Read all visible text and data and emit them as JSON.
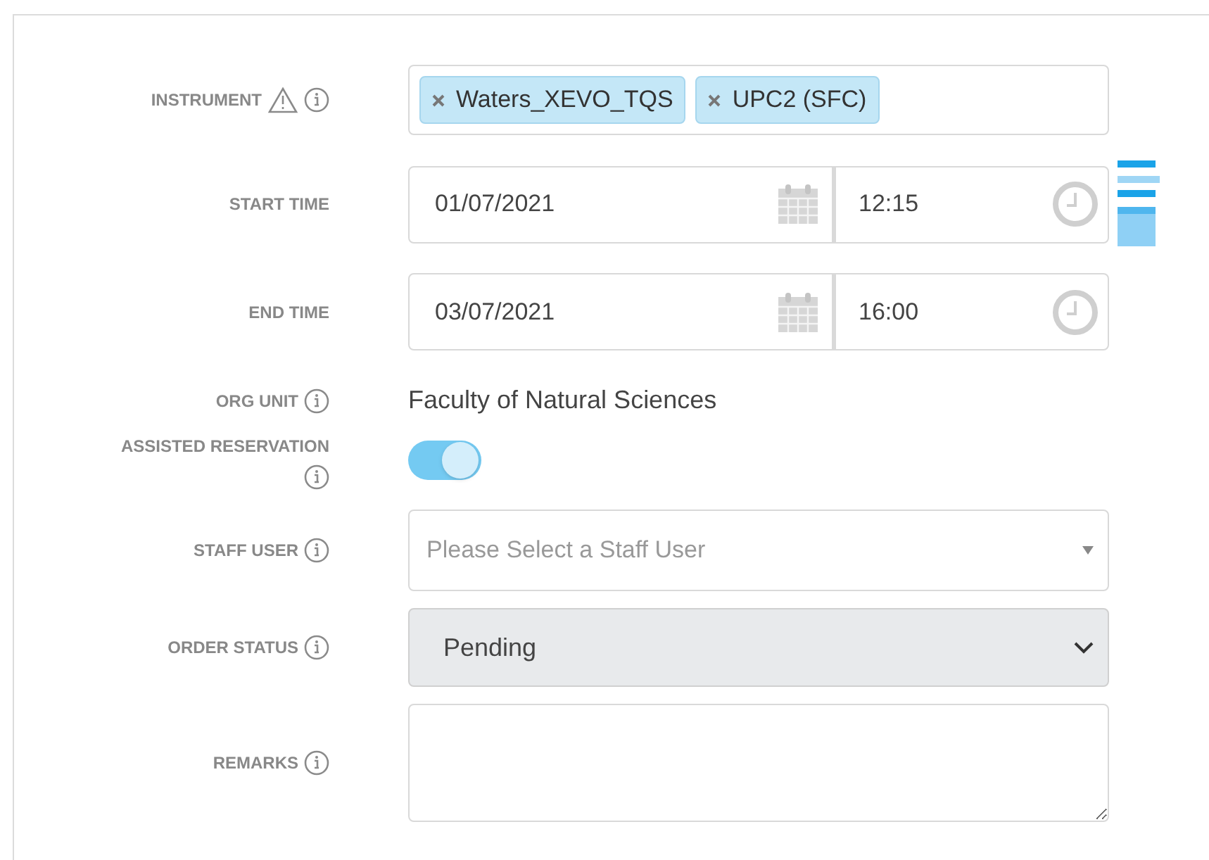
{
  "fields": [
    {
      "kind": "tags",
      "label": "INSTRUMENT",
      "warning": true,
      "info": true,
      "tags": [
        "Waters_XEVO_TQS",
        "UPC2 (SFC)"
      ]
    },
    {
      "kind": "datetime",
      "label": "START TIME",
      "info": false,
      "date": "01/07/2021",
      "time": "12:15",
      "side_icon": true
    },
    {
      "kind": "datetime",
      "label": "END TIME",
      "info": false,
      "date": "03/07/2021",
      "time": "16:00",
      "side_icon": false
    },
    {
      "kind": "text",
      "label": "ORG UNIT",
      "info": true,
      "value": "Faculty of Natural Sciences"
    },
    {
      "kind": "toggle",
      "label": "ASSISTED RESERVATION",
      "info": true,
      "on": true
    },
    {
      "kind": "select",
      "label": "STAFF USER",
      "info": true,
      "placeholder": "Please Select a Staff User"
    },
    {
      "kind": "dropdown",
      "label": "ORDER STATUS",
      "info": true,
      "value": "Pending",
      "disabled": true
    },
    {
      "kind": "textarea",
      "label": "REMARKS",
      "info": true
    }
  ]
}
